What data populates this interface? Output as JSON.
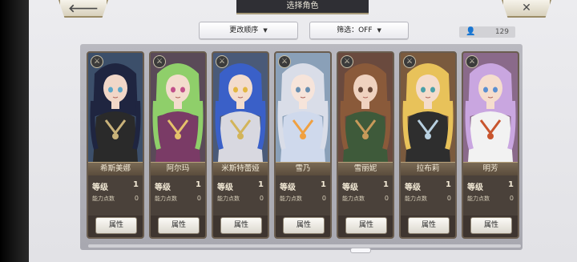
{
  "header": {
    "title": "选择角色",
    "back_icon": "🡐",
    "close_icon": "✕"
  },
  "controls": {
    "sort_label": "更改顺序",
    "filter_label": "筛选：OFF",
    "arrow": "▼",
    "person_icon": "👤",
    "count": "129"
  },
  "characters": [
    {
      "name": "希斯美娜",
      "level_label": "等级",
      "level": "1",
      "points_label": "能力点数",
      "points": "0",
      "button": "属性"
    },
    {
      "name": "阿尔玛",
      "level_label": "等级",
      "level": "1",
      "points_label": "能力点数",
      "points": "0",
      "button": "属性"
    },
    {
      "name": "米斯特蕾娅",
      "level_label": "等级",
      "level": "1",
      "points_label": "能力点数",
      "points": "0",
      "button": "属性"
    },
    {
      "name": "雪乃",
      "level_label": "等级",
      "level": "1",
      "points_label": "能力点数",
      "points": "0",
      "button": "属性"
    },
    {
      "name": "雪丽妮",
      "level_label": "等级",
      "level": "1",
      "points_label": "能力点数",
      "points": "0",
      "button": "属性"
    },
    {
      "name": "拉布莉",
      "level_label": "等级",
      "level": "1",
      "points_label": "能力点数",
      "points": "0",
      "button": "属性"
    },
    {
      "name": "明芳",
      "level_label": "等级",
      "level": "1",
      "points_label": "能力点数",
      "points": "0",
      "button": "属性"
    }
  ]
}
